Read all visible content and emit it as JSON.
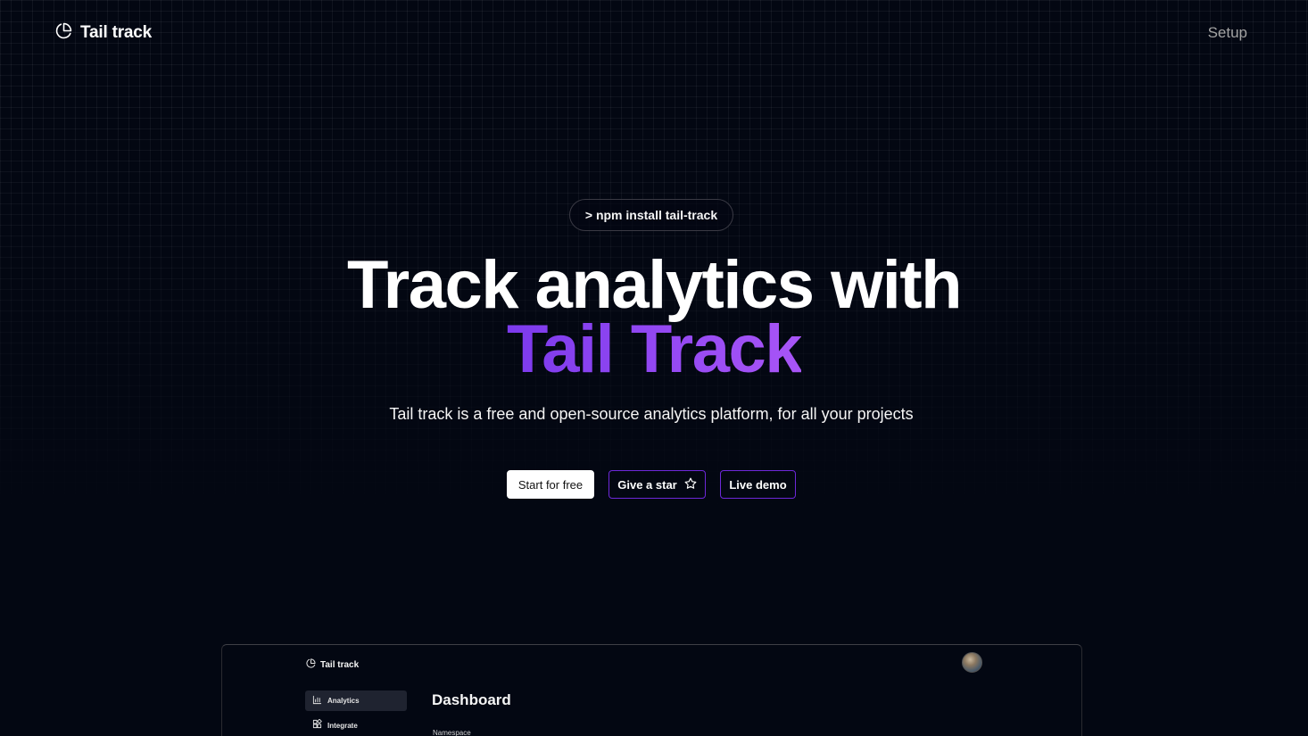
{
  "nav": {
    "logo_text": "Tail track",
    "setup_label": "Setup"
  },
  "hero": {
    "npm_command": "> npm install tail-track",
    "title_line1": "Track analytics with",
    "title_line2": "Tail Track",
    "subtitle": "Tail track is a free and open-source analytics platform, for all your projects",
    "buttons": {
      "start": "Start for free",
      "star": "Give a star",
      "demo": "Live demo"
    }
  },
  "preview": {
    "logo_text": "Tail track",
    "nav_items": [
      {
        "label": "Analytics",
        "icon": "bar-chart-icon",
        "active": true
      },
      {
        "label": "Integrate",
        "icon": "integrate-icon",
        "active": false
      }
    ],
    "page_title": "Dashboard",
    "field_label": "Namespace"
  },
  "colors": {
    "background": "#030712",
    "accent_purple": "#7c3aed",
    "accent_purple_light": "#a855f7",
    "button_border": "#6d28d9"
  }
}
